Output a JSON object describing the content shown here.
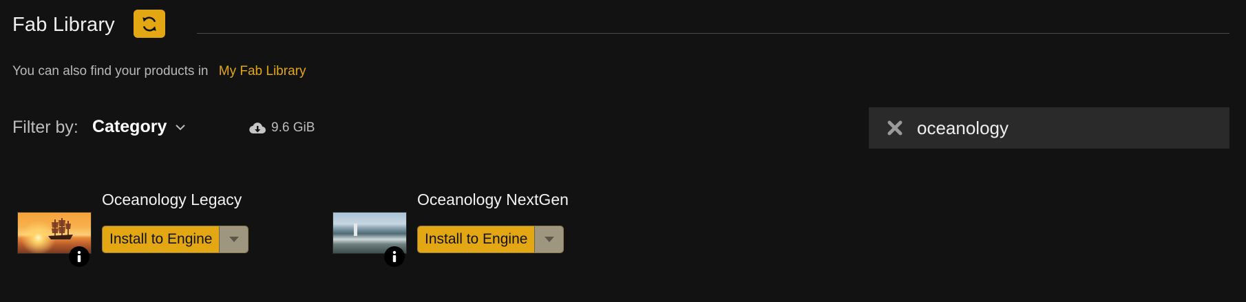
{
  "header": {
    "title": "Fab Library",
    "refresh_icon": "refresh-icon"
  },
  "subtitle": {
    "text": "You can also find your products in",
    "link_label": "My Fab Library"
  },
  "filter": {
    "label": "Filter by:",
    "category_label": "Category",
    "chevron_icon": "chevron-down-icon"
  },
  "storage": {
    "icon": "cloud-download-icon",
    "size": "9.6 GiB"
  },
  "search": {
    "value": "oceanology",
    "clear_icon": "close-icon"
  },
  "products": [
    {
      "name": "Oceanology Legacy",
      "install_label": "Install to Engine",
      "thumbnail": "sunset-ship"
    },
    {
      "name": "Oceanology NextGen",
      "install_label": "Install to Engine",
      "thumbnail": "rocky-coast"
    }
  ],
  "colors": {
    "accent": "#e3a713",
    "background": "#121212",
    "search_bg": "#2a2a2a",
    "dropdown_bg": "#9f9680"
  }
}
